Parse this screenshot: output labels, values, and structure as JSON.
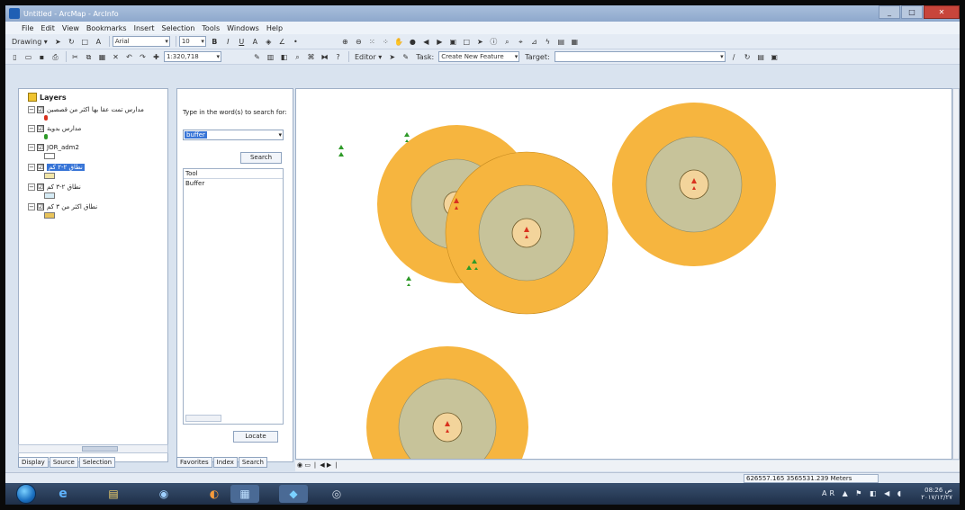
{
  "window": {
    "title": "Untitled - ArcMap - ArcInfo",
    "controls": [
      "_",
      "□",
      "✕"
    ]
  },
  "menu": [
    "File",
    "Edit",
    "View",
    "Bookmarks",
    "Insert",
    "Selection",
    "Tools",
    "Windows",
    "Help"
  ],
  "toolbar1": {
    "drawing_label": "Drawing ▾",
    "font_name": "Arial",
    "font_size": "10",
    "bold": "B",
    "italic": "I",
    "underline": "U"
  },
  "toolbar2": {
    "scale": "1:320,718",
    "editor_label": "Editor ▾",
    "task_label": "Task:",
    "task_value": "Create New Feature",
    "target_label": "Target:"
  },
  "toc": {
    "root_label": "Layers",
    "layers": [
      {
        "name": "مدارس تمت عقا بها اكثر من قصصين",
        "checked": "☑",
        "symbol": "point",
        "color": "#d9321f"
      },
      {
        "name": "مدارس بدوية",
        "checked": "☑",
        "symbol": "point",
        "color": "#2e9a28"
      },
      {
        "name": "JOR_adm2",
        "checked": "☑",
        "symbol": "polygon",
        "color": "#ffffff"
      },
      {
        "name": "نطاق ٢-٢ كم",
        "checked": "☑",
        "symbol": "polygon",
        "color": "#f2e6a8"
      },
      {
        "name": "نطاق ٢-٣ كم",
        "checked": "☑",
        "symbol": "polygon",
        "color": "#d6ebf5"
      },
      {
        "name": "نطاق اكثر من ٣ كم",
        "checked": "☑",
        "symbol": "polygon",
        "color": "#e8c35a"
      }
    ],
    "tabs": [
      "Display",
      "Source",
      "Selection"
    ]
  },
  "search_window": {
    "prompt": "Type in the word(s) to search for:",
    "query": "buffer",
    "search_button": "Search",
    "results_header": "Tool",
    "results": [
      "Buffer"
    ],
    "locate_button": "Locate",
    "tabs": [
      "Favorites",
      "Index",
      "Search"
    ]
  },
  "map": {
    "buffer_colors": {
      "outer": "#f6b53f",
      "middle": "#c7c39a",
      "inner": "#f3d49b"
    },
    "school_colors": {
      "multi_shift": "#d9321f",
      "bedouin": "#2e9a28"
    }
  },
  "status": {
    "coordinates": "626557.165  3565531.239 Meters"
  },
  "taskbar": {
    "apps": [
      "e",
      "▤",
      "◉",
      "◐",
      "▦",
      "◆",
      "◎"
    ],
    "tray_icons": "AR ▲ ⚑ ◧ ◀ ◖",
    "time": "08:26 ص",
    "date": "٢٠١٧/١٢/٢٧"
  }
}
